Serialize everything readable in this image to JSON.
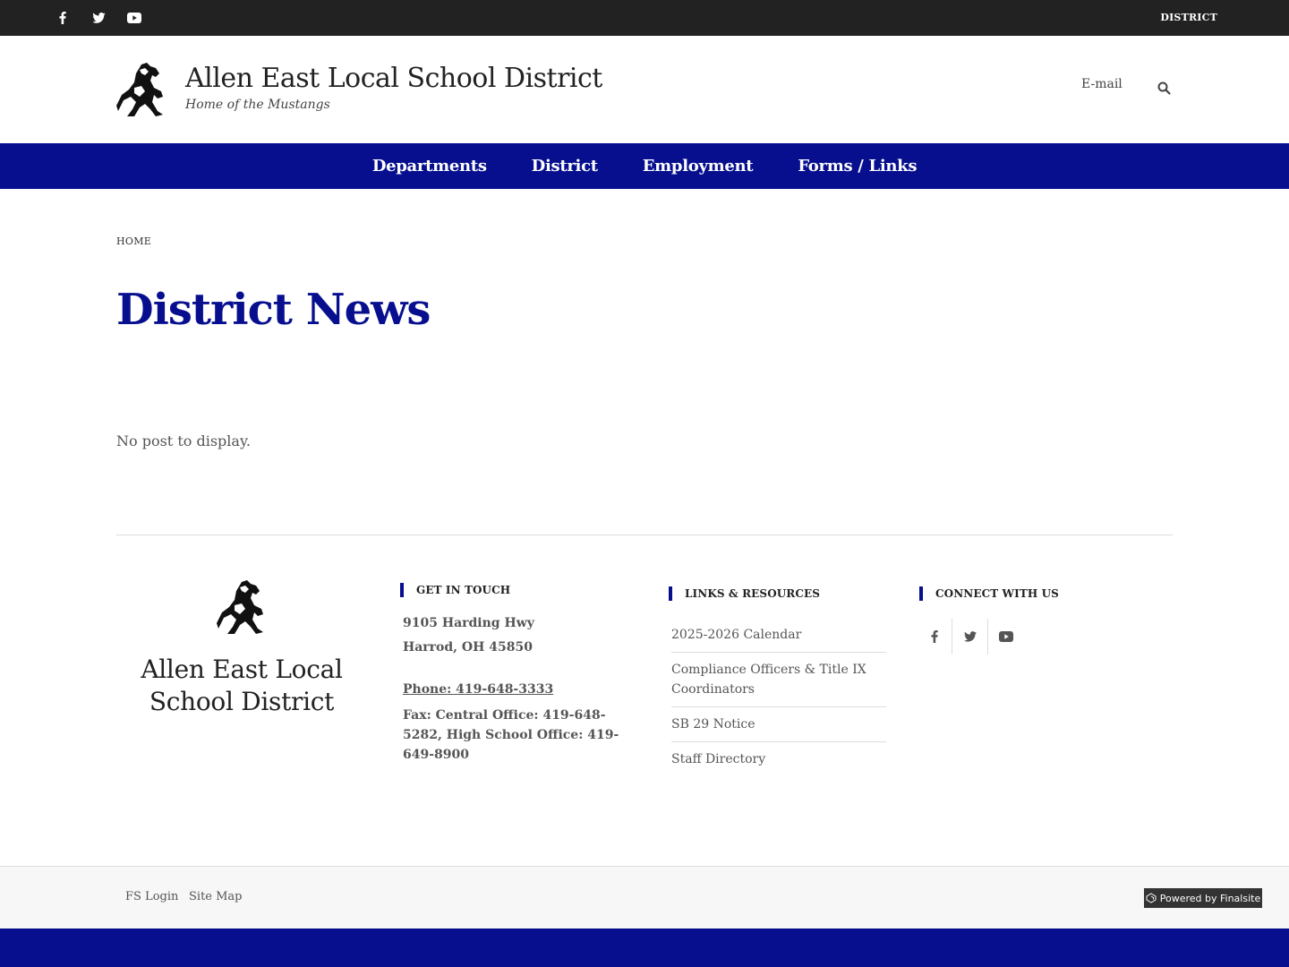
{
  "topbar": {
    "social": [
      {
        "icon": "facebook-icon"
      },
      {
        "icon": "twitter-icon"
      },
      {
        "icon": "youtube-icon"
      }
    ],
    "district_link": "DISTRICT"
  },
  "header": {
    "title": "Allen East Local School District",
    "tagline": "Home of the Mustangs",
    "email_label": "E-mail",
    "search_icon": "search-icon"
  },
  "nav": {
    "items": [
      "Departments",
      "District",
      "Employment",
      "Forms / Links"
    ]
  },
  "breadcrumb": "HOME",
  "page_title": "District News",
  "empty_message": "No post to display.",
  "footer": {
    "name": "Allen East Local School District",
    "get_in_touch": {
      "heading": "GET IN TOUCH",
      "address_line1": "9105 Harding Hwy",
      "address_line2": "Harrod, OH  45850",
      "phone": "Phone: 419-648-3333",
      "fax": "Fax: Central Office: 419-648-5282, High School Office: 419-649-8900"
    },
    "links": {
      "heading": "LINKS & RESOURCES",
      "items": [
        "2025-2026 Calendar",
        "Compliance Officers & Title IX Coordinators",
        "SB 29 Notice",
        "Staff Directory"
      ]
    },
    "connect": {
      "heading": "CONNECT WITH US"
    }
  },
  "bottom": {
    "fs_login": "FS Login",
    "site_map": "Site Map",
    "powered_by": "Powered by Finalsite"
  },
  "colors": {
    "brand_blue": "#070f8f",
    "topbar": "#222222"
  }
}
